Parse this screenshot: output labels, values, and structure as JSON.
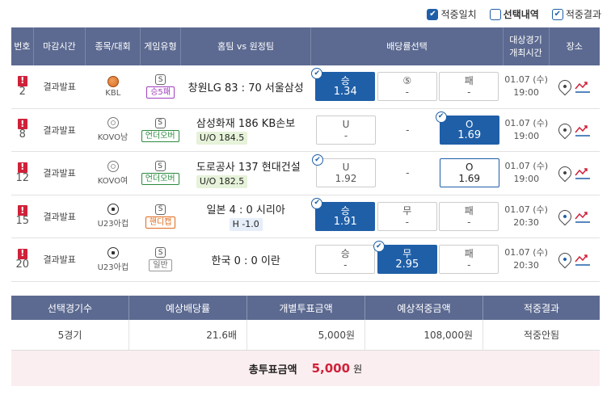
{
  "filters": [
    {
      "label": "적중일치",
      "state": "checked"
    },
    {
      "label": "선택내역",
      "state": "unchecked"
    },
    {
      "label": "적중결과",
      "state": "outline"
    }
  ],
  "headers": {
    "no": "번호",
    "deadline": "마감시간",
    "sport": "종목/대회",
    "type": "게임유형",
    "match": "홈팀 vs 원정팀",
    "odds": "배당률선택",
    "time": "대상경기\n개최시간",
    "place": "장소"
  },
  "rows": [
    {
      "no": "2",
      "deadline": "결과발표",
      "league": "KBL",
      "type_icon": "S",
      "type": "승5패",
      "match": "창원LG 83 : 70 서울삼성",
      "sub": "",
      "odds": [
        {
          "lbl": "승",
          "val": "1.34"
        },
        {
          "lbl": "⑤",
          "val": "-"
        },
        {
          "lbl": "패",
          "val": "-"
        }
      ],
      "date": "01.07 (수)",
      "time": "19:00"
    },
    {
      "no": "8",
      "deadline": "결과발표",
      "league": "KOVO남",
      "type_icon": "S",
      "type": "언더오버",
      "match": "삼성화재 186 KB손보",
      "sub": "U/O 184.5",
      "odds": [
        {
          "lbl": "U",
          "val": "-"
        },
        {
          "lbl": "",
          "val": "-"
        },
        {
          "lbl": "O",
          "val": "1.69"
        }
      ],
      "date": "01.07 (수)",
      "time": "19:00"
    },
    {
      "no": "12",
      "deadline": "결과발표",
      "league": "KOVO여",
      "type_icon": "S",
      "type": "언더오버",
      "match": "도로공사 137 현대건설",
      "sub": "U/O 182.5",
      "odds": [
        {
          "lbl": "U",
          "val": "1.92"
        },
        {
          "lbl": "",
          "val": "-"
        },
        {
          "lbl": "O",
          "val": "1.69"
        }
      ],
      "date": "01.07 (수)",
      "time": "19:00"
    },
    {
      "no": "15",
      "deadline": "결과발표",
      "league": "U23아컵",
      "type_icon": "S",
      "type": "핸디캡",
      "match": "일본 4 : 0 시리아",
      "sub": "H -1.0",
      "odds": [
        {
          "lbl": "승",
          "val": "1.91"
        },
        {
          "lbl": "무",
          "val": "-"
        },
        {
          "lbl": "패",
          "val": "-"
        }
      ],
      "date": "01.07 (수)",
      "time": "20:30"
    },
    {
      "no": "20",
      "deadline": "결과발표",
      "league": "U23아컵",
      "type_icon": "S",
      "type": "일반",
      "match": "한국 0 : 0 이란",
      "sub": "",
      "odds": [
        {
          "lbl": "승",
          "val": "-"
        },
        {
          "lbl": "무",
          "val": "2.95"
        },
        {
          "lbl": "패",
          "val": "-"
        }
      ],
      "date": "01.07 (수)",
      "time": "20:30"
    }
  ],
  "summary": {
    "headers": [
      "선택경기수",
      "예상배당률",
      "개별투표금액",
      "예상적중금액",
      "적중결과"
    ],
    "values": [
      "5경기",
      "21.6배",
      "5,000원",
      "108,000원",
      "적중안됨"
    ],
    "total_label": "총투표금액",
    "total_value": "5,000",
    "total_unit": "원"
  }
}
